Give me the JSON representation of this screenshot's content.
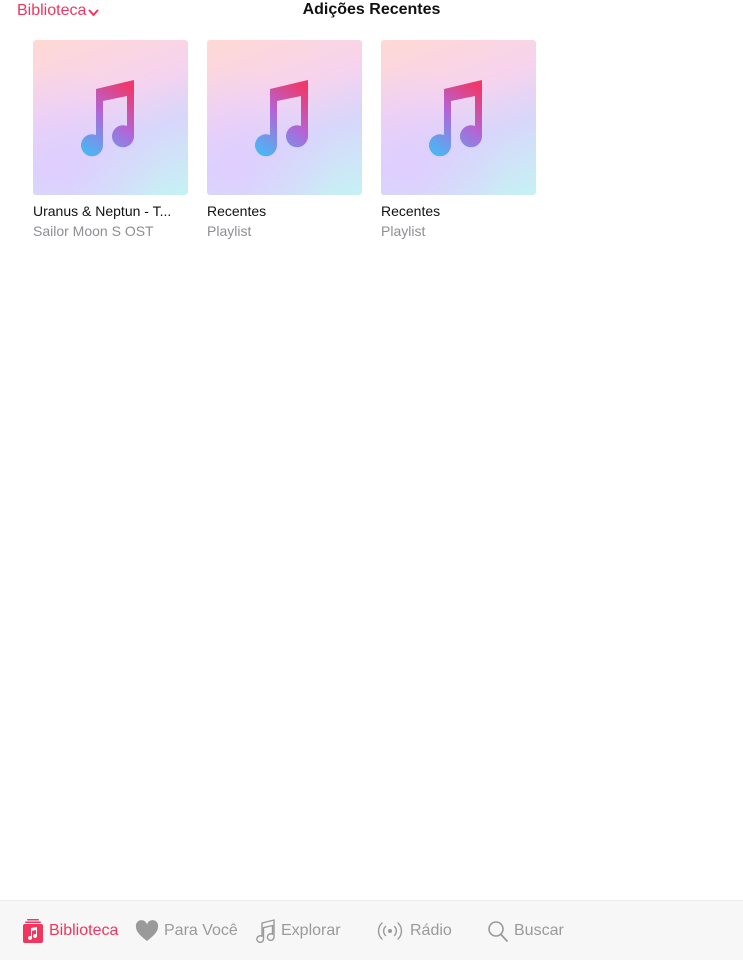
{
  "header": {
    "back_label": "Biblioteca",
    "title": "Adições Recentes"
  },
  "items": [
    {
      "title": "Uranus & Neptun - T...",
      "subtitle": "Sailor Moon S OST",
      "artwork_icon": "music-note-icon"
    },
    {
      "title": "Recentes",
      "subtitle": "Playlist",
      "artwork_icon": "music-note-icon"
    },
    {
      "title": "Recentes",
      "subtitle": "Playlist",
      "artwork_icon": "music-note-icon"
    }
  ],
  "tab_bar": {
    "active_index": 0,
    "tabs": [
      {
        "label": "Biblioteca",
        "icon": "library-icon"
      },
      {
        "label": "Para Você",
        "icon": "heart-icon"
      },
      {
        "label": "Explorar",
        "icon": "music-note-icon"
      },
      {
        "label": "Rádio",
        "icon": "radio-icon"
      },
      {
        "label": "Buscar",
        "icon": "search-icon"
      }
    ]
  },
  "colors": {
    "accent": "#f0365f",
    "inactive": "#9a9a9a"
  }
}
